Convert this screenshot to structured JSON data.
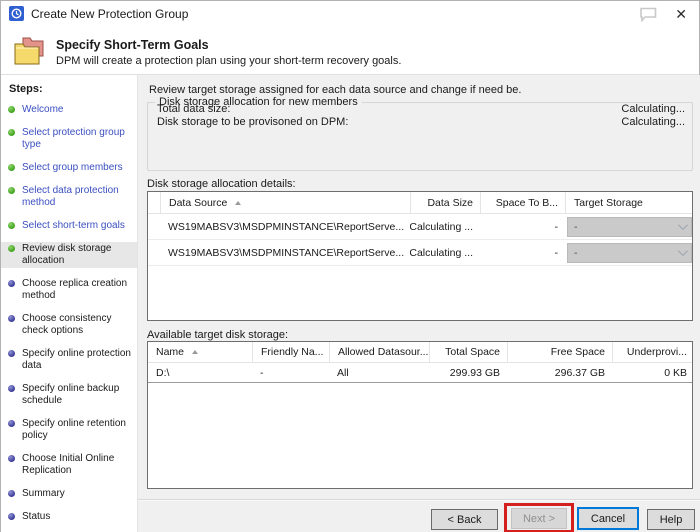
{
  "window": {
    "title": "Create New Protection Group",
    "close_glyph": "✕"
  },
  "icons": {
    "app": "dpm-clock-badge",
    "feedback": "speech-bubble",
    "close": "x-glyph",
    "header": "stacked-folders",
    "sort": "caret-up-ascending",
    "dropdown": "chevron-down"
  },
  "header": {
    "title": "Specify Short-Term Goals",
    "subtitle": "DPM will create a protection plan using your short-term recovery goals."
  },
  "sidebar": {
    "heading": "Steps:",
    "items": [
      {
        "label": "Welcome",
        "state": "completed"
      },
      {
        "label": "Select protection group type",
        "state": "completed"
      },
      {
        "label": "Select group members",
        "state": "completed"
      },
      {
        "label": "Select data protection method",
        "state": "completed"
      },
      {
        "label": "Select short-term goals",
        "state": "completed"
      },
      {
        "label": "Review disk storage allocation",
        "state": "current"
      },
      {
        "label": "Choose replica creation method",
        "state": "pending"
      },
      {
        "label": "Choose consistency check options",
        "state": "pending"
      },
      {
        "label": "Specify online protection data",
        "state": "pending"
      },
      {
        "label": "Specify online backup schedule",
        "state": "pending"
      },
      {
        "label": "Specify online retention policy",
        "state": "pending"
      },
      {
        "label": "Choose Initial Online Replication",
        "state": "pending"
      },
      {
        "label": "Summary",
        "state": "pending"
      },
      {
        "label": "Status",
        "state": "pending"
      }
    ]
  },
  "main": {
    "intro": "Review target storage assigned for each data source and change if need be.",
    "allocation_group": {
      "title": "Disk storage allocation for new members",
      "rows": [
        {
          "label": "Total data size:",
          "value": "Calculating..."
        },
        {
          "label": "Disk storage to be provisoned on DPM:",
          "value": "Calculating..."
        }
      ]
    },
    "details_table": {
      "label": "Disk storage allocation details:",
      "columns": [
        {
          "label": "Data Source",
          "align": "left",
          "sorted": true
        },
        {
          "label": "Data Size",
          "align": "right"
        },
        {
          "label": "Space To B...",
          "align": "right"
        },
        {
          "label": "Target Storage",
          "align": "left"
        }
      ],
      "rows": [
        {
          "data_source": "WS19MABSV3\\MSDPMINSTANCE\\ReportServe...",
          "data_size": "Calculating ...",
          "space_to_be": "-",
          "target_storage": "-"
        },
        {
          "data_source": "WS19MABSV3\\MSDPMINSTANCE\\ReportServe...",
          "data_size": "Calculating ...",
          "space_to_be": "-",
          "target_storage": "-"
        }
      ]
    },
    "available_table": {
      "label": "Available target disk storage:",
      "columns": [
        {
          "label": "Name",
          "align": "left",
          "sorted": true
        },
        {
          "label": "Friendly Na...",
          "align": "left"
        },
        {
          "label": "Allowed Datasour...",
          "align": "left"
        },
        {
          "label": "Total Space",
          "align": "right"
        },
        {
          "label": "Free Space",
          "align": "right"
        },
        {
          "label": "Underprovi...",
          "align": "right"
        }
      ],
      "rows": [
        {
          "name": "D:\\",
          "friendly_name": "-",
          "allowed_datasources": "All",
          "total_space": "299.93 GB",
          "free_space": "296.37 GB",
          "underprovisioned": "0 KB"
        }
      ]
    }
  },
  "footer": {
    "back": "< Back",
    "next": "Next >",
    "cancel": "Cancel",
    "help": "Help",
    "next_disabled": true,
    "cancel_focused": true
  },
  "colors": {
    "link_blue": "#3b4fc0",
    "completed_green": "#3fa21e",
    "pending_navy": "#3a3a95",
    "highlight_red": "#d41f1f",
    "focus_blue": "#0078d7"
  }
}
